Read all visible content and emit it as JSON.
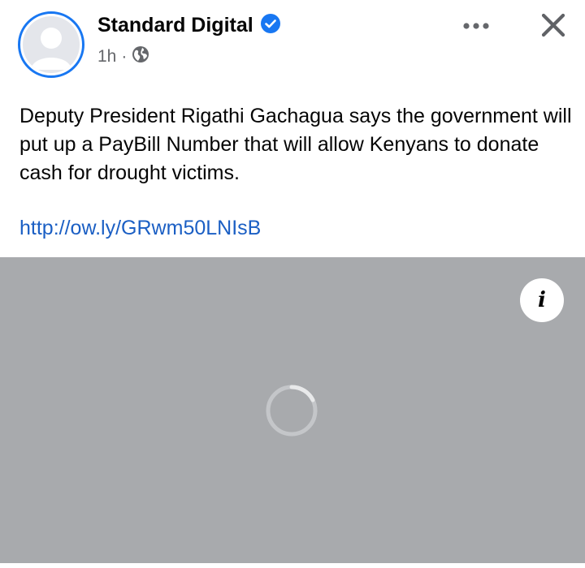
{
  "post": {
    "author": "Standard Digital",
    "verified": true,
    "time": "1h",
    "separator": "·",
    "visibility_icon": "globe-icon",
    "text": "Deputy President Rigathi Gachagua says the government will put up a PayBill Number that will allow Kenyans to donate cash for drought victims.",
    "link": "http://ow.ly/GRwm50LNIsB"
  },
  "header_actions": {
    "more_icon": "more-options-icon",
    "close_icon": "close-icon"
  },
  "media": {
    "state": "loading",
    "info_label": "i"
  },
  "colors": {
    "accent": "#1877f2",
    "link": "#1b5fc4",
    "media_bg": "#a8aaad",
    "meta_text": "#65676b"
  }
}
